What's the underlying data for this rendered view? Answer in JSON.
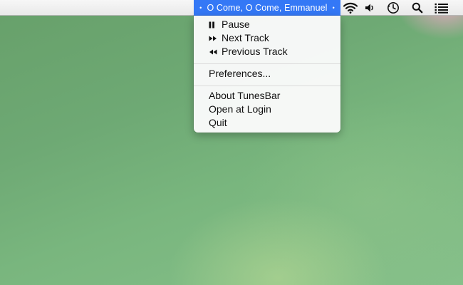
{
  "menubar": {
    "now_playing": "O Come, O Come, Emmanuel",
    "dot_left": "•",
    "dot_right": "•",
    "icons": [
      "wifi-icon",
      "volume-icon",
      "time-machine-icon",
      "spotlight-search-icon",
      "notification-center-icon"
    ],
    "accent_color": "#3478f6"
  },
  "menu": {
    "pause": "Pause",
    "next_track": "Next Track",
    "previous_track": "Previous Track",
    "preferences": "Preferences...",
    "about": "About TunesBar",
    "open_at_login": "Open at Login",
    "quit": "Quit"
  }
}
